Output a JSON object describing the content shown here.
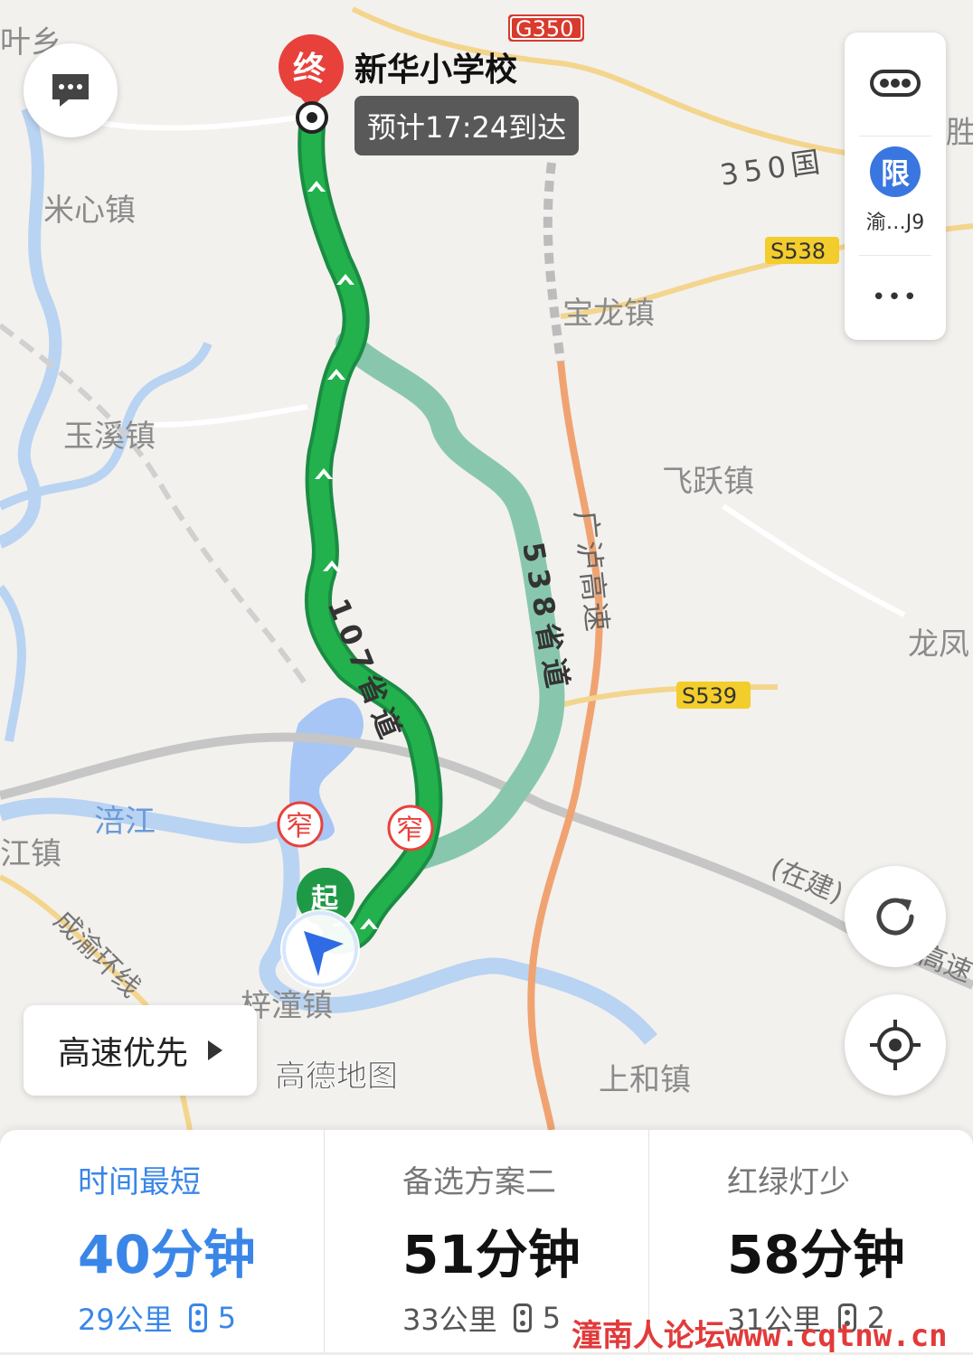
{
  "map": {
    "towns": [
      "叶乡",
      "米心镇",
      "玉溪镇",
      "宝龙镇",
      "飞跃镇",
      "龙凤",
      "胜",
      "江镇",
      "梓潼镇",
      "上和镇"
    ],
    "rivers": [
      "涪江"
    ],
    "roads": [
      "成渝环线",
      "(在建)",
      "高速"
    ],
    "shields": [
      "G350",
      "S538",
      "S539"
    ],
    "road_names": {
      "guo350": "350国",
      "sheng107": "107省道",
      "sheng538": "538省道",
      "guanglu": "广泸高速"
    },
    "narrow_markers": [
      "窄",
      "窄"
    ],
    "start_marker": "起",
    "end_marker": "终",
    "logo": "高德地图"
  },
  "destination": {
    "name": "新华小学校",
    "eta": "预计17:24到达"
  },
  "side_panel": {
    "restriction_badge": "限",
    "plate": "渝…J9",
    "more": "•••"
  },
  "preference": {
    "label": "高速优先"
  },
  "routes": [
    {
      "label": "时间最短",
      "duration": "40分钟",
      "distance": "29公里",
      "lights": "5",
      "active": true
    },
    {
      "label": "备选方案二",
      "duration": "51分钟",
      "distance": "33公里",
      "lights": "5",
      "active": false
    },
    {
      "label": "红绿灯少",
      "duration": "58分钟",
      "distance": "31公里",
      "lights": "2",
      "active": false
    }
  ],
  "watermark": {
    "cn": "潼南人论坛",
    "site": "www.cqtnw.cn"
  },
  "colors": {
    "active_route": "#1ea14b",
    "alt_route": "#88c7ae",
    "accent": "#3a86e8",
    "marker_red": "#e8413c",
    "highway": "#f0a371"
  }
}
